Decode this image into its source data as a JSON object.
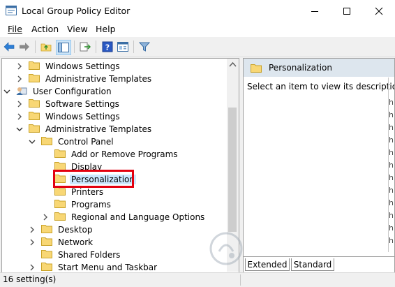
{
  "window": {
    "title": "Local Group Policy Editor"
  },
  "menu": [
    "File",
    "Action",
    "View",
    "Help"
  ],
  "tree": [
    {
      "label": "Windows Settings",
      "expander": "collapsed",
      "icon": "folder"
    },
    {
      "label": "Administrative Templates",
      "expander": "collapsed",
      "icon": "folder"
    },
    {
      "label": "User Configuration",
      "expander": "expanded",
      "icon": "user-config"
    },
    {
      "label": "Software Settings",
      "expander": "collapsed",
      "icon": "folder"
    },
    {
      "label": "Windows Settings",
      "expander": "collapsed",
      "icon": "folder"
    },
    {
      "label": "Administrative Templates",
      "expander": "expanded",
      "icon": "folder"
    },
    {
      "label": "Control Panel",
      "expander": "expanded",
      "icon": "folder"
    },
    {
      "label": "Add or Remove Programs",
      "expander": "none",
      "icon": "folder"
    },
    {
      "label": "Display",
      "expander": "none",
      "icon": "folder"
    },
    {
      "label": "Personalization",
      "expander": "none",
      "icon": "folder",
      "selected": true
    },
    {
      "label": "Printers",
      "expander": "none",
      "icon": "folder"
    },
    {
      "label": "Programs",
      "expander": "none",
      "icon": "folder"
    },
    {
      "label": "Regional and Language Options",
      "expander": "collapsed",
      "icon": "folder"
    },
    {
      "label": "Desktop",
      "expander": "collapsed",
      "icon": "folder"
    },
    {
      "label": "Network",
      "expander": "collapsed",
      "icon": "folder"
    },
    {
      "label": "Shared Folders",
      "expander": "none",
      "icon": "folder"
    },
    {
      "label": "Start Menu and Taskbar",
      "expander": "collapsed",
      "icon": "folder"
    }
  ],
  "right": {
    "heading": "Personalization",
    "description": "Select an item to view its description."
  },
  "tabs": [
    "Extended",
    "Standard"
  ],
  "status": "16 setting(s)",
  "colors": {
    "highlight": "#e3000f",
    "selection": "#cce8ff",
    "folder": "#f8d775"
  }
}
